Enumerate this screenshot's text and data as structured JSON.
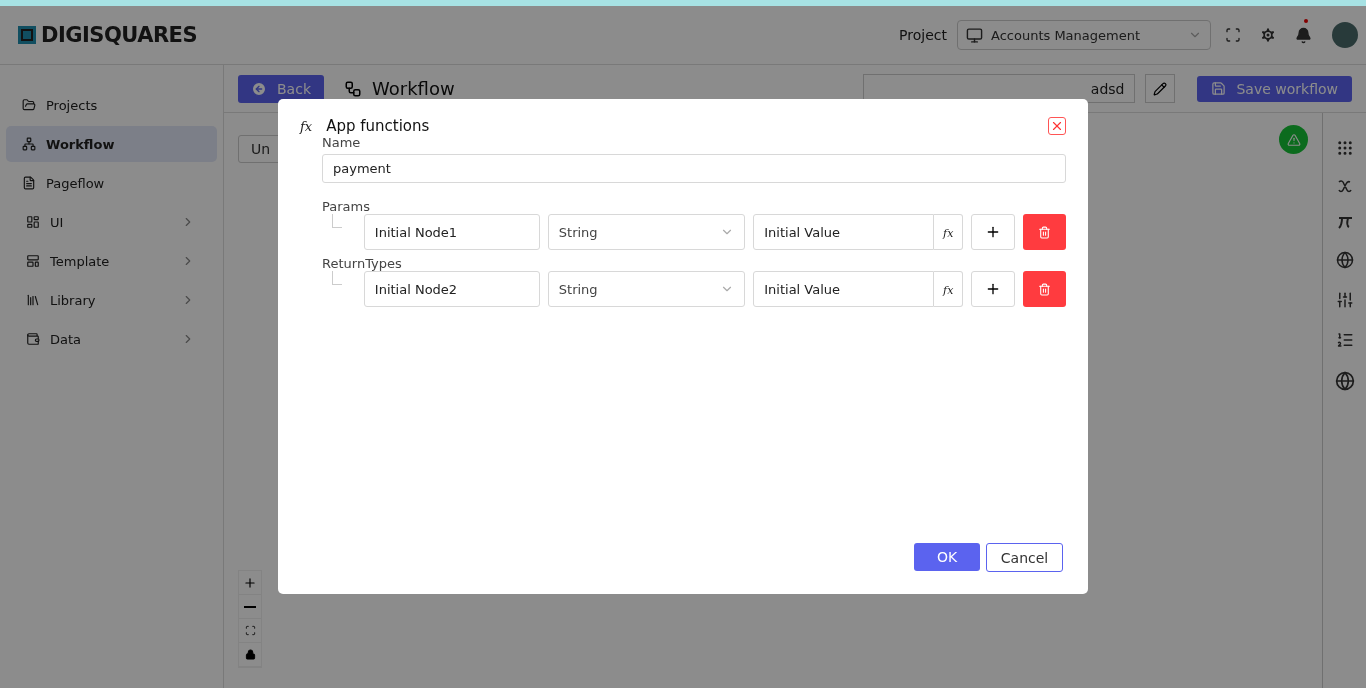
{
  "brand": "DIGISQUARES",
  "header": {
    "project_label": "Project",
    "project": "Accounts Management",
    "notification_unread": true
  },
  "sidebar": {
    "items": [
      {
        "label": "Projects",
        "selected": false,
        "has_children": false
      },
      {
        "label": "Workflow",
        "selected": true,
        "has_children": false
      },
      {
        "label": "Pageflow",
        "selected": false,
        "has_children": false
      },
      {
        "label": "UI",
        "selected": false,
        "has_children": true
      },
      {
        "label": "Template",
        "selected": false,
        "has_children": true
      },
      {
        "label": "Library",
        "selected": false,
        "has_children": true
      },
      {
        "label": "Data",
        "selected": false,
        "has_children": true
      }
    ]
  },
  "toolbar": {
    "back": "Back",
    "title": "Workflow",
    "name_value": "adsd",
    "save": "Save workflow"
  },
  "canvas": {
    "button_label": "Un"
  },
  "dialog": {
    "icon": "fx",
    "title": "App functions",
    "name_label": "Name",
    "name_value": "payment",
    "sections": [
      {
        "label": "Params",
        "rows": [
          {
            "name": "Initial Node1",
            "type": "String",
            "value": "Initial Value",
            "fx": "fx"
          }
        ]
      },
      {
        "label": "ReturnTypes",
        "rows": [
          {
            "name": "Initial Node2",
            "type": "String",
            "value": "Initial Value",
            "fx": "fx"
          }
        ]
      }
    ],
    "ok": "OK",
    "cancel": "Cancel"
  }
}
